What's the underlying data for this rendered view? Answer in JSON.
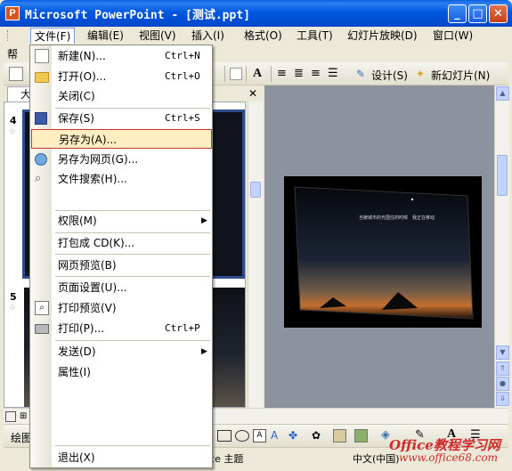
{
  "window": {
    "title": "Microsoft PowerPoint - [测试.ppt]",
    "app_icon": "powerpoint-icon",
    "controls": [
      "_",
      "□",
      "✕"
    ]
  },
  "menubar": {
    "items": [
      "文件(F)",
      "编辑(E)",
      "视图(V)",
      "插入(I)",
      "格式(O)",
      "工具(T)",
      "幻灯片放映(D)",
      "窗口(W)"
    ],
    "help_partial": "帮"
  },
  "toolbar": {
    "design_label": "设计(S)",
    "new_slide_label": "新幻灯片(N)"
  },
  "panes": {
    "outline_tab_partial": "大",
    "close": "✕",
    "slide_numbers": [
      "4",
      "5"
    ]
  },
  "slide": {
    "caption_left": "当被城市的光围住的时候",
    "caption_right": "我正在移动"
  },
  "statusbar": {
    "theme": "ice 主题",
    "language": "中文(中国)",
    "drawing_partial": "绘图"
  },
  "file_menu": {
    "items": [
      {
        "label": "新建(N)...",
        "shortcut": "Ctrl+N",
        "icon": "new-document-icon"
      },
      {
        "label": "打开(O)...",
        "shortcut": "Ctrl+O",
        "icon": "open-folder-icon"
      },
      {
        "label": "关闭(C)",
        "shortcut": "",
        "icon": ""
      },
      {
        "label": "保存(S)",
        "shortcut": "Ctrl+S",
        "icon": "save-disk-icon"
      },
      {
        "label": "另存为(A)...",
        "shortcut": "",
        "icon": ""
      },
      {
        "label": "另存为网页(G)...",
        "shortcut": "",
        "icon": "save-as-web-icon"
      },
      {
        "label": "文件搜索(H)...",
        "shortcut": "",
        "icon": "file-search-icon"
      },
      {
        "label": "权限(M)",
        "shortcut": "",
        "icon": ""
      },
      {
        "label": "打包成 CD(K)...",
        "shortcut": "",
        "icon": ""
      },
      {
        "label": "网页预览(B)",
        "shortcut": "",
        "icon": ""
      },
      {
        "label": "页面设置(U)...",
        "shortcut": "",
        "icon": ""
      },
      {
        "label": "打印预览(V)",
        "shortcut": "",
        "icon": "print-preview-icon"
      },
      {
        "label": "打印(P)...",
        "shortcut": "Ctrl+P",
        "icon": "print-icon"
      },
      {
        "label": "发送(D)",
        "shortcut": "",
        "icon": ""
      },
      {
        "label": "属性(I)",
        "shortcut": "",
        "icon": ""
      },
      {
        "label": "退出(X)",
        "shortcut": "",
        "icon": ""
      }
    ],
    "highlighted": "另存为(A)..."
  },
  "watermark": {
    "text": "Office教程学习网",
    "url": "www.office68.com"
  },
  "colors": {
    "title_bar": "#0058E0",
    "menu_highlight": "#FFEEC2",
    "highlight_border": "#C0392B",
    "watermark": "#D12A2A"
  }
}
